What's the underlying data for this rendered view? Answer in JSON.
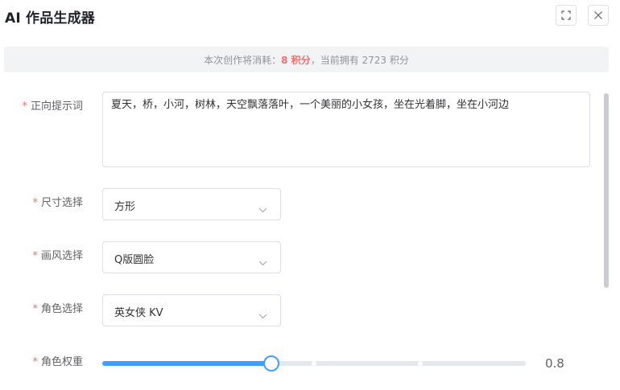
{
  "dialog": {
    "title": "AI 作品生成器",
    "fullscreen_icon": "fullscreen-icon",
    "close_icon": "close-icon"
  },
  "notice": {
    "prefix": "本次创作将消耗：",
    "cost": "8 积分",
    "suffix": "，当前拥有 2723 积分"
  },
  "form": {
    "required_mark": "*",
    "prompt": {
      "label": "正向提示词",
      "value": "夏天，桥，小河，树林，天空飘落落叶，一个美丽的小女孩，坐在光着脚，坐在小河边"
    },
    "size": {
      "label": "尺寸选择",
      "value": "方形"
    },
    "style": {
      "label": "画风选择",
      "value": "Q版圆脸"
    },
    "character": {
      "label": "角色选择",
      "value": "英女侠 KV"
    },
    "weight": {
      "label": "角色权重",
      "value_text": "0.8",
      "min": 0,
      "max": 2,
      "value": 0.8,
      "stops": [
        0.5,
        1.0,
        1.5
      ]
    }
  },
  "colors": {
    "accent": "#409eff",
    "cost": "#f56c6c",
    "required": "#f56c6c"
  }
}
